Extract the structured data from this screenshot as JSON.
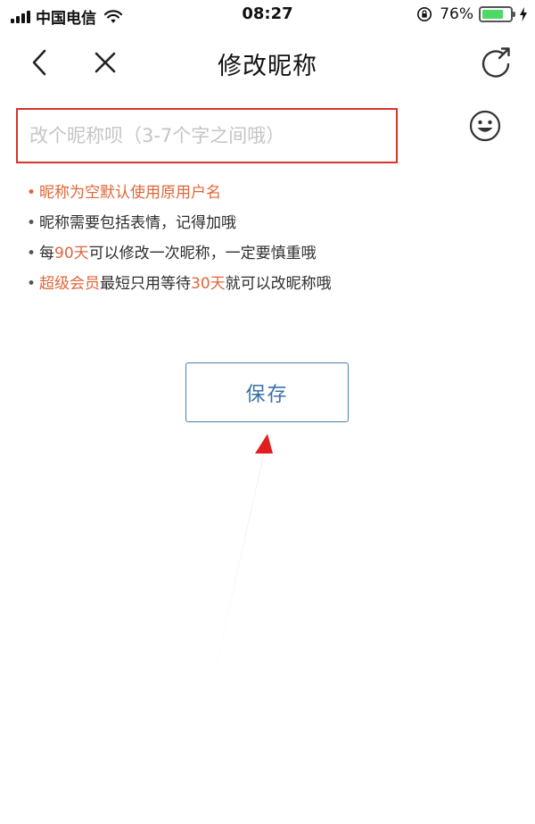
{
  "status_bar": {
    "carrier": "中国电信",
    "time": "08:27",
    "battery_percent": "76%",
    "battery_level": 0.76,
    "signal_icon": "signal-bars-icon",
    "wifi_icon": "wifi-icon",
    "orientation_lock_icon": "orientation-lock-icon",
    "charging_icon": "charging-bolt-icon"
  },
  "nav": {
    "title": "修改昵称",
    "back_icon": "chevron-left-icon",
    "close_icon": "close-icon",
    "share_icon": "share-icon"
  },
  "nickname_field": {
    "placeholder": "改个昵称呗（3-7个字之间哦）",
    "value": "",
    "emoji_icon": "smiley-icon"
  },
  "rules": [
    {
      "prefix": "",
      "highlight": "昵称为空默认使用原用户名",
      "suffix": ""
    },
    {
      "text": "昵称需要包括表情，记得加哦"
    },
    {
      "prefix": "每",
      "highlight": "90天",
      "suffix": "可以修改一次昵称，一定要慎重哦"
    },
    {
      "prefix": "",
      "highlight": "超级会员",
      "middle": "最短只用等待",
      "highlight2": "30天",
      "suffix": "就可以改昵称哦"
    }
  ],
  "save_button": {
    "label": "保存"
  },
  "colors": {
    "input_border": "#d6342b",
    "highlight_text": "#e0663a",
    "button_border": "#4a7eb0",
    "button_text": "#3a70a8",
    "annotation_arrow": "#e02020",
    "battery_fill": "#4cd964"
  }
}
